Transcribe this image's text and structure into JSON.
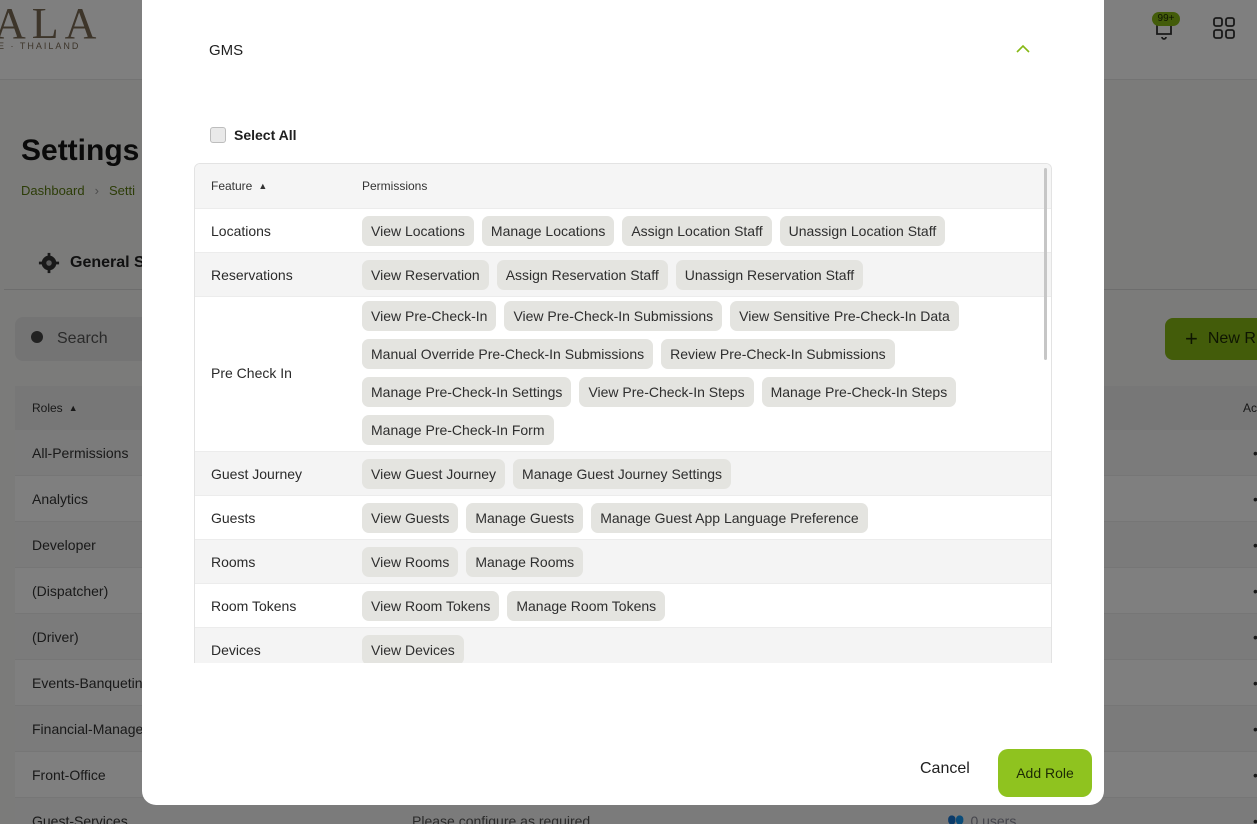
{
  "background": {
    "logo": {
      "text": "ALA",
      "sub": "E · THAILAND"
    },
    "notifications_badge": "99+",
    "page_title": "Settings",
    "breadcrumb": [
      "Dashboard",
      "Setti"
    ],
    "tab_label": "General S",
    "search_placeholder": "Search",
    "new_button_label": "New R",
    "roles_table": {
      "header": {
        "roles": "Roles",
        "actions": "Ac"
      },
      "rows": [
        {
          "name": "All-Permissions"
        },
        {
          "name": "Analytics"
        },
        {
          "name": "Developer"
        },
        {
          "name": "(Dispatcher)"
        },
        {
          "name": "(Driver)"
        },
        {
          "name": "Events-Banqueting"
        },
        {
          "name": "Financial-Manage"
        },
        {
          "name": "Front-Office"
        },
        {
          "name": "Guest-Services",
          "description": "Please configure as required",
          "users": "0 users"
        }
      ]
    },
    "colors": {
      "accent": "#86b814"
    }
  },
  "modal": {
    "section_title": "GMS",
    "select_all_label": "Select All",
    "table": {
      "header": {
        "feature": "Feature",
        "permissions": "Permissions"
      },
      "rows": [
        {
          "feature": "Locations",
          "permissions": [
            "View Locations",
            "Manage Locations",
            "Assign Location Staff",
            "Unassign Location Staff"
          ]
        },
        {
          "feature": "Reservations",
          "permissions": [
            "View Reservation",
            "Assign Reservation Staff",
            "Unassign Reservation Staff"
          ]
        },
        {
          "feature": "Pre Check In",
          "permissions": [
            "View Pre-Check-In",
            "View Pre-Check-In Submissions",
            "View Sensitive Pre-Check-In Data",
            "Manual Override Pre-Check-In Submissions",
            "Review Pre-Check-In Submissions",
            "Manage Pre-Check-In Settings",
            "View Pre-Check-In Steps",
            "Manage Pre-Check-In Steps",
            "Manage Pre-Check-In Form"
          ]
        },
        {
          "feature": "Guest Journey",
          "permissions": [
            "View Guest Journey",
            "Manage Guest Journey Settings"
          ]
        },
        {
          "feature": "Guests",
          "permissions": [
            "View Guests",
            "Manage Guests",
            "Manage Guest App Language Preference"
          ]
        },
        {
          "feature": "Rooms",
          "permissions": [
            "View Rooms",
            "Manage Rooms"
          ]
        },
        {
          "feature": "Room Tokens",
          "permissions": [
            "View Room Tokens",
            "Manage Room Tokens"
          ]
        },
        {
          "feature": "Devices",
          "permissions": [
            "View Devices"
          ]
        }
      ]
    },
    "cancel_label": "Cancel",
    "add_label": "Add Role",
    "colors": {
      "add_button": "#8fc31f",
      "chip": "#e4e4e0",
      "chevron": "#86b814"
    }
  }
}
